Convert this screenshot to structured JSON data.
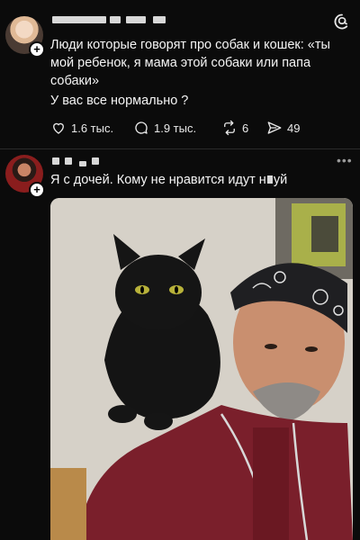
{
  "app": {
    "name": "Threads"
  },
  "post1": {
    "text": "Люди которые говорят про собак и кошек: «ты мой ребенок, я мама этой собаки или папа собаки»",
    "question": "У вас все нормально ?",
    "likes": "1.6 тыс.",
    "replies": "1.9 тыс.",
    "reposts": "6",
    "shares": "49"
  },
  "post2": {
    "text_before": "Я с дочей. Кому не нравится идут н",
    "text_after": "уй",
    "photo_alt_icon": "photo-man-with-black-cat"
  },
  "icons": {
    "like": "heart-icon",
    "reply": "comment-icon",
    "repost": "repost-icon",
    "share": "share-icon",
    "more": "more-icon",
    "follow": "plus-icon",
    "logo": "threads-logo-icon"
  },
  "colors": {
    "background": "#0b0b0b",
    "text": "#f5f5f5",
    "muted": "#9a9a9a"
  }
}
